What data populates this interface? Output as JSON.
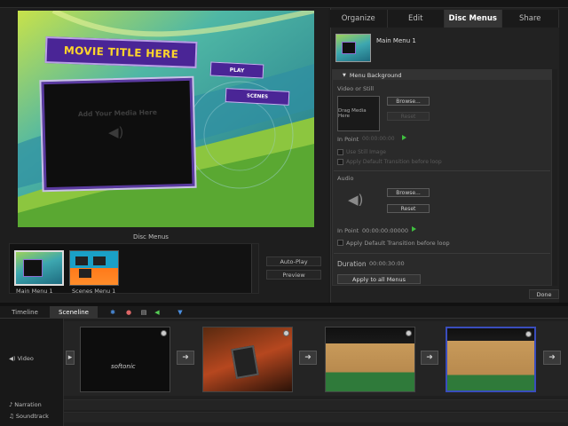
{
  "colors": {
    "accent_purple": "#4a2596",
    "title_yellow": "#ffd52b",
    "green_play": "#3fbf3f",
    "selected_clip": "#3a4dbd"
  },
  "preview": {
    "title_text": "MOVIE TITLE HERE",
    "play_label": "PLAY",
    "scenes_label": "SCENES",
    "dropzone_text": "Add Your Media Here"
  },
  "menus_panel": {
    "label": "Disc Menus",
    "items": [
      {
        "label": "Main Menu 1"
      },
      {
        "label": "Scenes Menu 1"
      }
    ],
    "autoplay_label": "Auto-Play",
    "preview_label": "Preview"
  },
  "tabs": [
    {
      "label": "Organize"
    },
    {
      "label": "Edit"
    },
    {
      "label": "Disc Menus"
    },
    {
      "label": "Share"
    }
  ],
  "properties": {
    "selected_menu": "Main Menu 1",
    "section": "Menu Background",
    "video_or_still": "Video or Still",
    "drag_media": "Drag Media Here",
    "browse": "Browse...",
    "reset": "Reset",
    "in_point": "In Point",
    "video_in_value": "00:00:00:00",
    "use_still": "Use Still Image",
    "apply_default_video": "Apply Default Transition before loop",
    "audio": "Audio",
    "audio_browse": "Browse...",
    "audio_reset": "Reset",
    "audio_in_point": "In Point",
    "audio_in_value": "00:00:00:00000",
    "apply_default_audio": "Apply Default Transition before loop",
    "duration_label": "Duration",
    "duration_value": "00:00:30:00",
    "apply_all": "Apply to all Menus",
    "done": "Done"
  },
  "timeline": {
    "tabs": [
      {
        "label": "Timeline"
      },
      {
        "label": "Sceneline"
      }
    ],
    "tracks": {
      "video": "Video",
      "narration": "Narration",
      "soundtrack": "Soundtrack"
    },
    "clip_logo": "softonic"
  }
}
